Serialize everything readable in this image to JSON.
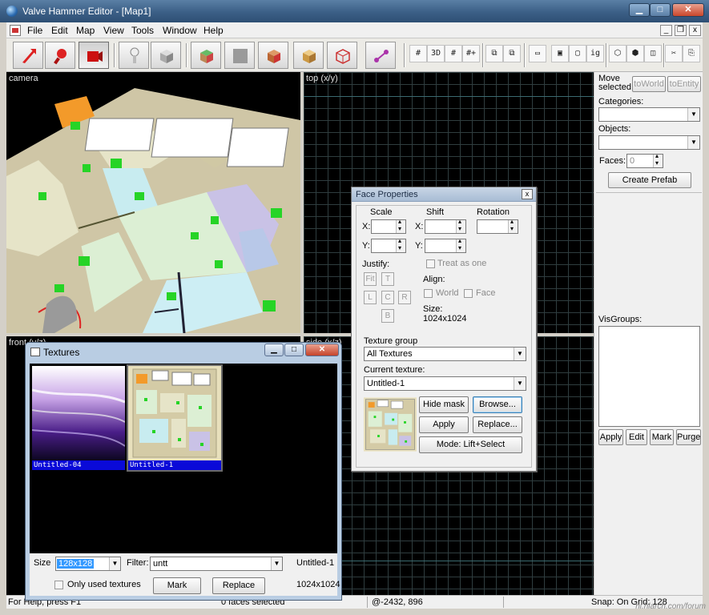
{
  "window": {
    "title": "Valve Hammer Editor - [Map1]",
    "controls": {
      "minimize": "▁",
      "maximize": "□",
      "close": "✕"
    }
  },
  "menu": {
    "items": [
      "File",
      "Edit",
      "Map",
      "View",
      "Tools",
      "Window",
      "Help"
    ],
    "mdi_controls": {
      "minimize": "_",
      "restore": "❐",
      "close": "x"
    }
  },
  "toolbar": {
    "main_tools": [
      {
        "name": "selection-tool",
        "icon": "arrow-icon"
      },
      {
        "name": "magnify-tool",
        "icon": "magnify-icon"
      },
      {
        "name": "camera-tool",
        "icon": "camera-icon"
      },
      {
        "name": "entity-tool",
        "icon": "entity-icon"
      },
      {
        "name": "block-tool",
        "icon": "block-icon"
      },
      {
        "name": "texture-application-tool",
        "icon": "texture-icon"
      },
      {
        "name": "apply-current-texture-tool",
        "icon": "apply-texture-icon"
      },
      {
        "name": "decal-tool",
        "icon": "decal-icon"
      },
      {
        "name": "clipping-tool",
        "icon": "clip-icon"
      },
      {
        "name": "vertex-tool",
        "icon": "vertex-icon"
      },
      {
        "name": "path-tool",
        "icon": "path-icon"
      }
    ],
    "small_tools": [
      "#",
      "3D",
      "#",
      "#+",
      "⧉",
      "⧉",
      "▭",
      "▣",
      "▢",
      "ig",
      "⬡",
      "⬢",
      "◫",
      "✂",
      "⎘",
      "📋"
    ]
  },
  "viewports": {
    "camera": {
      "label": "camera"
    },
    "top": {
      "label": "top (x/y)"
    },
    "front": {
      "label": "front (y/z)"
    },
    "side": {
      "label": "side (x/z)"
    }
  },
  "right_panel": {
    "move_selected_label": "Move selected:",
    "to_world_button": "toWorld",
    "to_entity_button": "toEntity",
    "categories_label": "Categories:",
    "categories_value": "",
    "objects_label": "Objects:",
    "objects_value": "",
    "faces_label": "Faces:",
    "faces_value": "0",
    "create_prefab_button": "Create Prefab",
    "visgroups_label": "VisGroups:",
    "apply_button": "Apply",
    "edit_button": "Edit",
    "mark_button": "Mark",
    "purge_button": "Purge"
  },
  "face_properties": {
    "title": "Face Properties",
    "close": "x",
    "scale_label": "Scale",
    "shift_label": "Shift",
    "rotation_label": "Rotation",
    "x_label": "X:",
    "y_label": "Y:",
    "scale_x": "",
    "scale_y": "",
    "shift_x": "",
    "shift_y": "",
    "rotation": "",
    "justify_label": "Justify:",
    "justify_buttons": {
      "fit": "Fit",
      "top": "T",
      "left": "L",
      "center": "C",
      "right": "R",
      "bottom": "B"
    },
    "treat_as_one_label": "Treat as one",
    "align_label": "Align:",
    "world_label": "World",
    "face_label": "Face",
    "size_label": "Size:",
    "size_value": "1024x1024",
    "texture_group_label": "Texture group",
    "texture_group_value": "All Textures",
    "current_texture_label": "Current texture:",
    "current_texture_value": "Untitled-1",
    "hide_mask_button": "Hide mask",
    "browse_button": "Browse...",
    "apply_button": "Apply",
    "replace_button": "Replace...",
    "mode_button": "Mode: Lift+Select"
  },
  "textures_window": {
    "title": "Textures",
    "controls": {
      "minimize": "▁",
      "maximize": "□",
      "close": "✕"
    },
    "tiles": [
      {
        "caption": "Untitled-04"
      },
      {
        "caption": "Untitled-1"
      }
    ],
    "size_label": "Size",
    "size_value": "128x128",
    "filter_label": "Filter:",
    "filter_value": "untt",
    "selected_name": "Untitled-1",
    "selected_size": "1024x1024",
    "only_used_label": "Only used textures",
    "mark_button": "Mark",
    "replace_button": "Replace"
  },
  "status": {
    "help": "For Help, press F1",
    "selection": "0 faces selected",
    "coords": "@-2432, 896",
    "snap": "Snap: On Grid: 128",
    "watermark": "hl.hlarch.com/forum"
  },
  "colors": {
    "title_bar": "#3b5f86",
    "grid_line": "#2f3d3f",
    "texture_caption_bg": "#0a0ad8",
    "selection_highlight": "#3399ff"
  }
}
